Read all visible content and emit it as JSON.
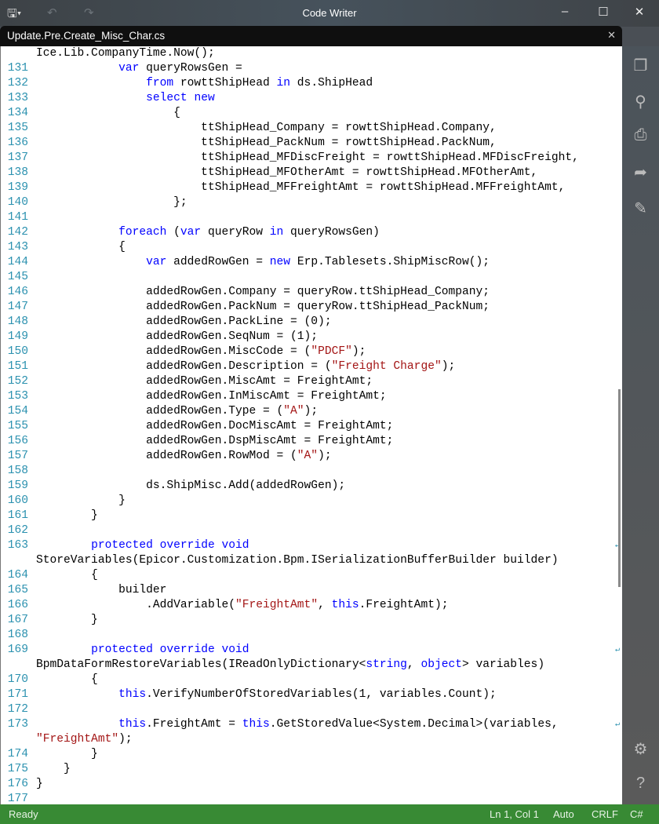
{
  "window": {
    "title": "Code Writer"
  },
  "tab": {
    "label": "Update.Pre.Create_Misc_Char.cs"
  },
  "status": {
    "state": "Ready",
    "position": "Ln 1, Col 1",
    "indent": "Auto",
    "line_ending": "CRLF",
    "language": "C#"
  },
  "colors": {
    "keyword": "#0000ff",
    "string": "#a31515",
    "line_number": "#2b91af",
    "status_bar": "#388a34"
  },
  "lines": [
    {
      "n": "",
      "t": [
        [
          "",
          "Ice.Lib.CompanyTime.Now();"
        ]
      ]
    },
    {
      "n": "131",
      "t": [
        [
          "",
          "            "
        ],
        [
          "kw",
          "var"
        ],
        [
          "",
          " queryRowsGen ="
        ]
      ]
    },
    {
      "n": "132",
      "t": [
        [
          "",
          "                "
        ],
        [
          "kw",
          "from"
        ],
        [
          "",
          " rowttShipHead "
        ],
        [
          "kw",
          "in"
        ],
        [
          "",
          " ds.ShipHead"
        ]
      ]
    },
    {
      "n": "133",
      "t": [
        [
          "",
          "                "
        ],
        [
          "kw",
          "select"
        ],
        [
          "",
          " "
        ],
        [
          "kw",
          "new"
        ]
      ]
    },
    {
      "n": "134",
      "t": [
        [
          "",
          "                    {"
        ]
      ]
    },
    {
      "n": "135",
      "t": [
        [
          "",
          "                        ttShipHead_Company = rowttShipHead.Company,"
        ]
      ]
    },
    {
      "n": "136",
      "t": [
        [
          "",
          "                        ttShipHead_PackNum = rowttShipHead.PackNum,"
        ]
      ]
    },
    {
      "n": "137",
      "t": [
        [
          "",
          "                        ttShipHead_MFDiscFreight = rowttShipHead.MFDiscFreight,"
        ]
      ]
    },
    {
      "n": "138",
      "t": [
        [
          "",
          "                        ttShipHead_MFOtherAmt = rowttShipHead.MFOtherAmt,"
        ]
      ]
    },
    {
      "n": "139",
      "t": [
        [
          "",
          "                        ttShipHead_MFFreightAmt = rowttShipHead.MFFreightAmt,"
        ]
      ]
    },
    {
      "n": "140",
      "t": [
        [
          "",
          "                    };"
        ]
      ]
    },
    {
      "n": "141",
      "t": []
    },
    {
      "n": "142",
      "t": [
        [
          "",
          "            "
        ],
        [
          "kw",
          "foreach"
        ],
        [
          "",
          " ("
        ],
        [
          "kw",
          "var"
        ],
        [
          "",
          " queryRow "
        ],
        [
          "kw",
          "in"
        ],
        [
          "",
          " queryRowsGen)"
        ]
      ]
    },
    {
      "n": "143",
      "t": [
        [
          "",
          "            {"
        ]
      ]
    },
    {
      "n": "144",
      "t": [
        [
          "",
          "                "
        ],
        [
          "kw",
          "var"
        ],
        [
          "",
          " addedRowGen = "
        ],
        [
          "kw",
          "new"
        ],
        [
          "",
          " Erp.Tablesets.ShipMiscRow();"
        ]
      ]
    },
    {
      "n": "145",
      "t": []
    },
    {
      "n": "146",
      "t": [
        [
          "",
          "                addedRowGen.Company = queryRow.ttShipHead_Company;"
        ]
      ]
    },
    {
      "n": "147",
      "t": [
        [
          "",
          "                addedRowGen.PackNum = queryRow.ttShipHead_PackNum;"
        ]
      ]
    },
    {
      "n": "148",
      "t": [
        [
          "",
          "                addedRowGen.PackLine = (0);"
        ]
      ]
    },
    {
      "n": "149",
      "t": [
        [
          "",
          "                addedRowGen.SeqNum = (1);"
        ]
      ]
    },
    {
      "n": "150",
      "t": [
        [
          "",
          "                addedRowGen.MiscCode = ("
        ],
        [
          "str",
          "\"PDCF\""
        ],
        [
          "",
          ");"
        ]
      ]
    },
    {
      "n": "151",
      "t": [
        [
          "",
          "                addedRowGen.Description = ("
        ],
        [
          "str",
          "\"Freight Charge\""
        ],
        [
          "",
          ");"
        ]
      ]
    },
    {
      "n": "152",
      "t": [
        [
          "",
          "                addedRowGen.MiscAmt = FreightAmt;"
        ]
      ]
    },
    {
      "n": "153",
      "t": [
        [
          "",
          "                addedRowGen.InMiscAmt = FreightAmt;"
        ]
      ]
    },
    {
      "n": "154",
      "t": [
        [
          "",
          "                addedRowGen.Type = ("
        ],
        [
          "str",
          "\"A\""
        ],
        [
          "",
          ");"
        ]
      ]
    },
    {
      "n": "155",
      "t": [
        [
          "",
          "                addedRowGen.DocMiscAmt = FreightAmt;"
        ]
      ]
    },
    {
      "n": "156",
      "t": [
        [
          "",
          "                addedRowGen.DspMiscAmt = FreightAmt;"
        ]
      ]
    },
    {
      "n": "157",
      "t": [
        [
          "",
          "                addedRowGen.RowMod = ("
        ],
        [
          "str",
          "\"A\""
        ],
        [
          "",
          ");"
        ]
      ]
    },
    {
      "n": "158",
      "t": []
    },
    {
      "n": "159",
      "t": [
        [
          "",
          "                ds.ShipMisc.Add(addedRowGen);"
        ]
      ]
    },
    {
      "n": "160",
      "t": [
        [
          "",
          "            }"
        ]
      ]
    },
    {
      "n": "161",
      "t": [
        [
          "",
          "        }"
        ]
      ]
    },
    {
      "n": "162",
      "t": []
    },
    {
      "n": "163",
      "w": true,
      "t": [
        [
          "",
          "        "
        ],
        [
          "kw",
          "protected"
        ],
        [
          "",
          " "
        ],
        [
          "kw",
          "override"
        ],
        [
          "",
          " "
        ],
        [
          "kw",
          "void"
        ]
      ]
    },
    {
      "n": "",
      "t": [
        [
          "",
          "StoreVariables(Epicor.Customization.Bpm.ISerializationBufferBuilder builder)"
        ]
      ]
    },
    {
      "n": "164",
      "t": [
        [
          "",
          "        {"
        ]
      ]
    },
    {
      "n": "165",
      "t": [
        [
          "",
          "            builder"
        ]
      ]
    },
    {
      "n": "166",
      "t": [
        [
          "",
          "                .AddVariable("
        ],
        [
          "str",
          "\"FreightAmt\""
        ],
        [
          "",
          ", "
        ],
        [
          "kw",
          "this"
        ],
        [
          "",
          ".FreightAmt);"
        ]
      ]
    },
    {
      "n": "167",
      "t": [
        [
          "",
          "        }"
        ]
      ]
    },
    {
      "n": "168",
      "t": []
    },
    {
      "n": "169",
      "w": true,
      "t": [
        [
          "",
          "        "
        ],
        [
          "kw",
          "protected"
        ],
        [
          "",
          " "
        ],
        [
          "kw",
          "override"
        ],
        [
          "",
          " "
        ],
        [
          "kw",
          "void"
        ]
      ]
    },
    {
      "n": "",
      "t": [
        [
          "",
          "BpmDataFormRestoreVariables(IReadOnlyDictionary<"
        ],
        [
          "kw",
          "string"
        ],
        [
          "",
          ", "
        ],
        [
          "kw",
          "object"
        ],
        [
          "",
          "> variables)"
        ]
      ]
    },
    {
      "n": "170",
      "t": [
        [
          "",
          "        {"
        ]
      ]
    },
    {
      "n": "171",
      "t": [
        [
          "",
          "            "
        ],
        [
          "kw",
          "this"
        ],
        [
          "",
          ".VerifyNumberOfStoredVariables(1, variables.Count);"
        ]
      ]
    },
    {
      "n": "172",
      "t": []
    },
    {
      "n": "173",
      "w": true,
      "t": [
        [
          "",
          "            "
        ],
        [
          "kw",
          "this"
        ],
        [
          "",
          ".FreightAmt = "
        ],
        [
          "kw",
          "this"
        ],
        [
          "",
          ".GetStoredValue<System.Decimal>(variables,"
        ]
      ]
    },
    {
      "n": "",
      "t": [
        [
          "str",
          "\"FreightAmt\""
        ],
        [
          "",
          ");"
        ]
      ]
    },
    {
      "n": "174",
      "t": [
        [
          "",
          "        }"
        ]
      ]
    },
    {
      "n": "175",
      "t": [
        [
          "",
          "    }"
        ]
      ]
    },
    {
      "n": "176",
      "t": [
        [
          "",
          "}"
        ]
      ]
    },
    {
      "n": "177",
      "t": []
    }
  ]
}
